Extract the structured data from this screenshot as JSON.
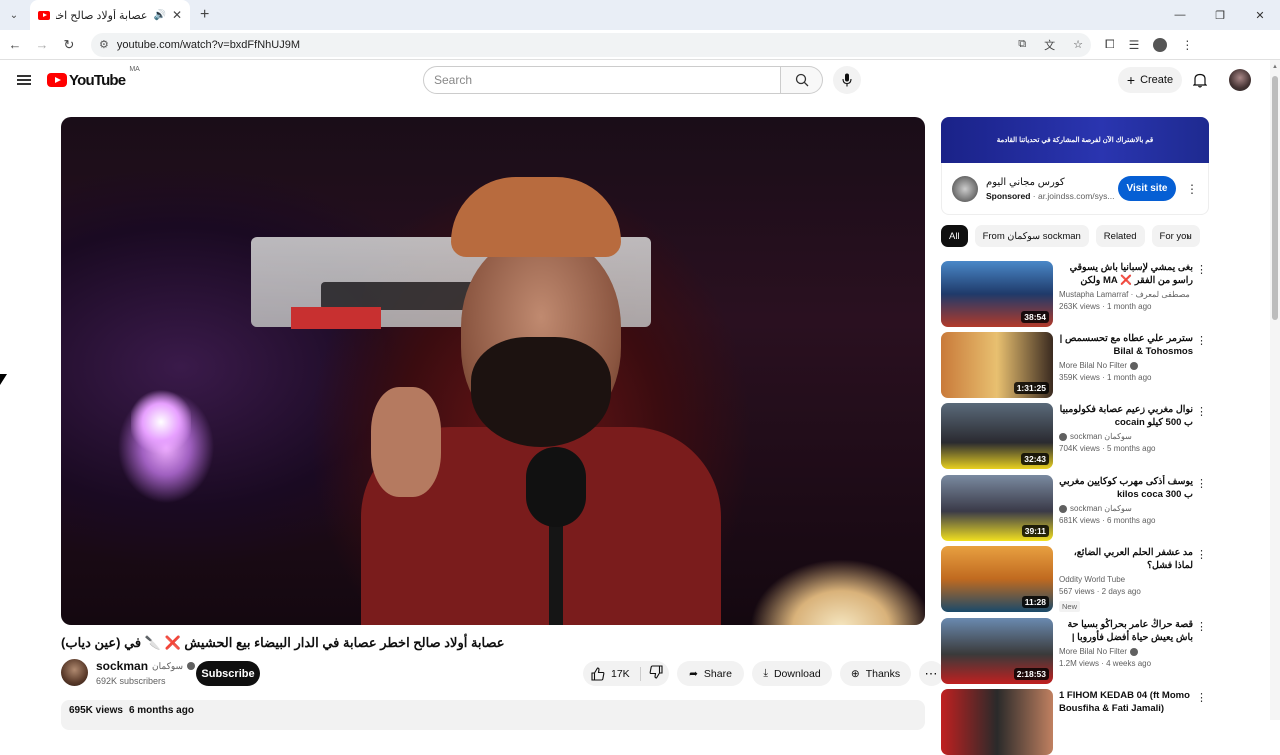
{
  "browser": {
    "tab_title": "عصابة أولاد صالح اخطر عصا...",
    "url": "youtube.com/watch?v=bxdFfNhUJ9M",
    "new_tab": "+",
    "tab_close": "✕"
  },
  "header": {
    "logo_text": "YouTube",
    "country_code": "MA",
    "search_placeholder": "Search",
    "create_label": "Create"
  },
  "video": {
    "title": "عصابة أولاد صالح اخطر عصابة في الدار البيضاء بيع الحشيش ❌ 🔪 في (عين دياب)",
    "channel_name": "sockman",
    "channel_name_ar": "سوكمان",
    "subscribers": "692K subscribers",
    "subscribe_label": "Subscribe",
    "likes": "17K",
    "share_label": "Share",
    "download_label": "Download",
    "thanks_label": "Thanks",
    "views": "695K views",
    "age": "6 months ago"
  },
  "ad": {
    "banner_text": "قم بالاشتراك الآن لفرصة المشاركة في تحدياتنا القادمة",
    "title": "كورس مجاني اليوم",
    "sponsored": "Sponsored",
    "domain": "ar.joindss.com/sys...",
    "visit_label": "Visit site"
  },
  "chips": [
    "All",
    "From سوكمان sockman",
    "Related",
    "For you"
  ],
  "recommendations": [
    {
      "title": "بغى يمشي لإسبانيا باش يسوقي راسو من الفقر ❌ MA ولكن ستدق طابع فالمشاكل...",
      "channel": "Mustapha Lamarraf · مصطفى لمعرف",
      "meta": "263K views · 1 month ago",
      "duration": "38:54",
      "verified": false,
      "new": ""
    },
    {
      "title": "سترمر علي عطاه مع تحسسمص | Bilal & Tohosmos",
      "channel": "More Bilal No Filter",
      "meta": "359K views · 1 month ago",
      "duration": "1:31:25",
      "verified": true,
      "new": ""
    },
    {
      "title": "نوال مغربي زعيم عصابة فكولومبيا ب 500 كيلو cocain",
      "channel": "sockman سوكمان",
      "meta": "704K views · 5 months ago",
      "duration": "32:43",
      "verified": true,
      "new": ""
    },
    {
      "title": "يوسف أذكى مهرب كوكايين مغربي ب 300 kilos coca",
      "channel": "sockman سوكمان",
      "meta": "681K views · 6 months ago",
      "duration": "39:11",
      "verified": true,
      "new": ""
    },
    {
      "title": "مد عشفر الحلم العربي الضائع، لماذا فشل؟",
      "channel": "Oddity World Tube",
      "meta": "567 views · 2 days ago",
      "duration": "11:28",
      "verified": false,
      "new": "New"
    },
    {
      "title": "قصة حراڭ عامر بحراڭو بسيا حة باش يعيش حياة أفضل فأوروبا | Le Bledard Full",
      "channel": "More Bilal No Filter",
      "meta": "1.2M views · 4 weeks ago",
      "duration": "2:18:53",
      "verified": true,
      "new": ""
    },
    {
      "title": "1 FIHOM KEDAB 04 (ft Momo Bousfiha & Fati Jamali)",
      "channel": "",
      "meta": "",
      "duration": "",
      "verified": false,
      "new": ""
    }
  ],
  "colors": {
    "brand_red": "#ff0000",
    "visit_blue": "#065fd4"
  }
}
